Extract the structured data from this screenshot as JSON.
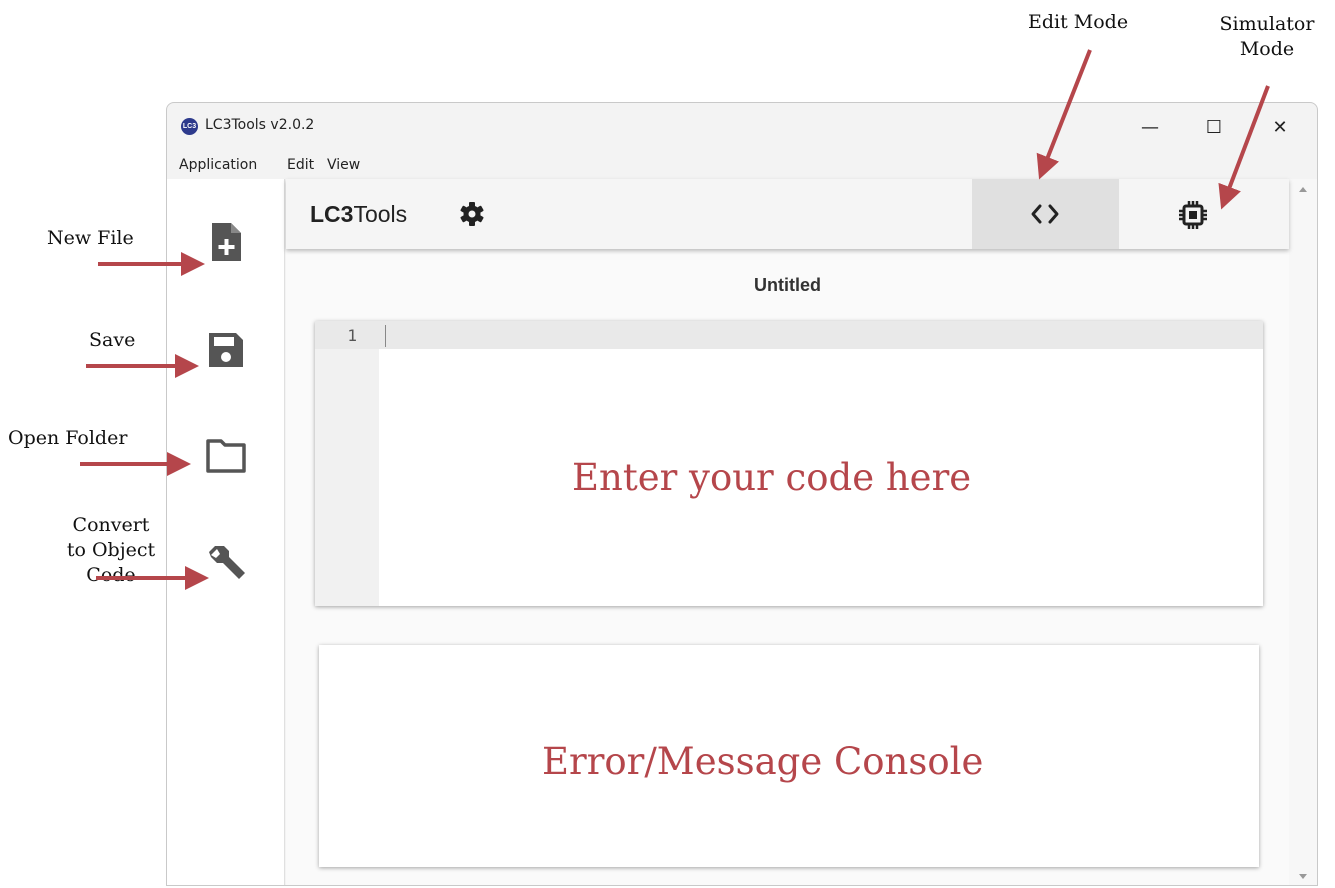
{
  "annotations": {
    "edit_mode": "Edit Mode",
    "simulator_mode_line1": "Simulator",
    "simulator_mode_line2": "Mode",
    "new_file": "New File",
    "save": "Save",
    "open_folder": "Open Folder",
    "convert_line1": "Convert",
    "convert_line2": "to Object",
    "convert_line3": "Code",
    "editor_overlay": "Enter your code here",
    "console_overlay": "Error/Message Console",
    "arrow_color": "#b5464b"
  },
  "window": {
    "icon_text": "LC3",
    "title": "LC3Tools v2.0.2",
    "minimize": "—",
    "maximize": "☐",
    "close": "✕"
  },
  "menu": {
    "items": [
      "Application",
      "Edit",
      "View"
    ]
  },
  "sidebar": {
    "icons": [
      "new-file-icon",
      "save-icon",
      "open-folder-icon",
      "wrench-icon"
    ]
  },
  "toolbar": {
    "brand_bold": "LC3",
    "brand_rest": "Tools",
    "settings_icon": "gear-icon",
    "edit_mode_icon": "code-brackets-icon",
    "simulator_mode_icon": "chip-icon"
  },
  "editor": {
    "file_title": "Untitled",
    "line_number": "1",
    "content": ""
  },
  "console": {
    "content": ""
  }
}
